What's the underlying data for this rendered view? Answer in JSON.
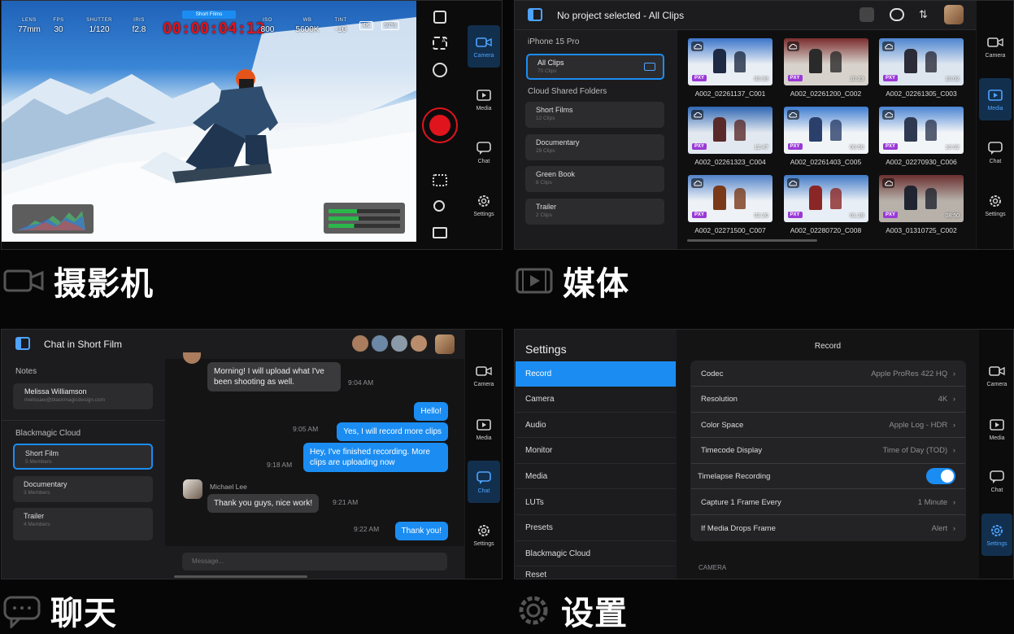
{
  "camera": {
    "hud": {
      "lens": {
        "label": "LENS",
        "value": "77mm"
      },
      "fps": {
        "label": "FPS",
        "value": "30"
      },
      "shutter": {
        "label": "SHUTTER",
        "value": "1/120"
      },
      "iris": {
        "label": "IRIS",
        "value": "f2.8"
      },
      "project_tag": "Short Films",
      "timecode": "00:00:04:12",
      "iso": {
        "label": "ISO",
        "value": "800"
      },
      "wb": {
        "label": "WB",
        "value": "5600K"
      },
      "tint": {
        "label": "TINT",
        "value": "-10"
      },
      "resolution_badge": "4K",
      "battery": "97%"
    },
    "nav_label": "Camera",
    "caption": "摄影机"
  },
  "rail": {
    "camera": "Camera",
    "media": "Media",
    "chat": "Chat",
    "settings": "Settings"
  },
  "media": {
    "header_title": "No project selected - All Clips",
    "device": "iPhone 15 Pro",
    "all_clips": {
      "label": "All Clips",
      "count": "70 Clips"
    },
    "shared_header": "Cloud Shared Folders",
    "folders": [
      {
        "name": "Short Films",
        "count": "12 Clips"
      },
      {
        "name": "Documentary",
        "count": "28 Clips"
      },
      {
        "name": "Green Book",
        "count": "8 Clips"
      },
      {
        "name": "Trailer",
        "count": "2 Clips"
      }
    ],
    "clips": [
      {
        "name": "A002_02261137_C001",
        "duration": "00:33",
        "badge": "PXY"
      },
      {
        "name": "A002_02261200_C002",
        "duration": "10:23",
        "badge": "PXY"
      },
      {
        "name": "A002_02261305_C003",
        "duration": "10:02",
        "badge": "PXY"
      },
      {
        "name": "A002_02261323_C004",
        "duration": "12:47",
        "badge": "PXY"
      },
      {
        "name": "A002_02261403_C005",
        "duration": "08:50",
        "badge": "PXY"
      },
      {
        "name": "A002_02270930_C006",
        "duration": "10:02",
        "badge": "PXY"
      },
      {
        "name": "A002_02271500_C007",
        "duration": "02:20",
        "badge": "PXY"
      },
      {
        "name": "A002_02280720_C008",
        "duration": "01:29",
        "badge": "PXY"
      },
      {
        "name": "A003_01310725_C002",
        "duration": "08:50",
        "badge": "PXY"
      }
    ],
    "caption": "媒体"
  },
  "chat": {
    "header_title": "Chat in Short Film",
    "notes_header": "Notes",
    "contact": {
      "name": "Melissa Williamson",
      "email": "melissaw@blackmagicdesign.com"
    },
    "cloud_header": "Blackmagic Cloud",
    "groups": [
      {
        "name": "Short Film",
        "members": "5 Members"
      },
      {
        "name": "Documentary",
        "members": "3 Members"
      },
      {
        "name": "Trailer",
        "members": "4 Members"
      }
    ],
    "messages": [
      {
        "dir": "in",
        "text": "Morning! I will upload what I've been shooting as well.",
        "time": "9:04 AM"
      },
      {
        "dir": "out",
        "text": "Hello!",
        "time": ""
      },
      {
        "dir": "out",
        "text": "Yes, I will record more clips",
        "time": "9:05 AM"
      },
      {
        "dir": "out",
        "text": "Hey, I've finished recording. More clips are uploading now",
        "time": "9:18 AM"
      },
      {
        "dir": "in",
        "sender": "Michael Lee",
        "text": "Thank you guys, nice work!",
        "time": "9:21 AM"
      },
      {
        "dir": "out",
        "text": "Thank you!",
        "time": "9:22 AM"
      }
    ],
    "input_placeholder": "Message...",
    "caption": "聊天"
  },
  "settings": {
    "title": "Settings",
    "nav": [
      "Record",
      "Camera",
      "Audio",
      "Monitor",
      "Media",
      "LUTs",
      "Presets",
      "Blackmagic Cloud",
      "Reset"
    ],
    "section_title": "Record",
    "rows": [
      {
        "label": "Codec",
        "value": "Apple ProRes 422 HQ"
      },
      {
        "label": "Resolution",
        "value": "4K"
      },
      {
        "label": "Color Space",
        "value": "Apple Log - HDR"
      },
      {
        "label": "Timecode Display",
        "value": "Time of Day (TOD)"
      },
      {
        "label": "Timelapse Recording",
        "value": "on"
      },
      {
        "label": "Capture 1 Frame Every",
        "value": "1 Minute"
      },
      {
        "label": "If Media Drops Frame",
        "value": "Alert"
      }
    ],
    "camera_section": "CAMERA",
    "caption": "设置"
  },
  "colors": {
    "accent": "#1b8df2",
    "record": "#e0141c",
    "proxy": "#9a3ad6",
    "timecode": "#e0141c"
  }
}
